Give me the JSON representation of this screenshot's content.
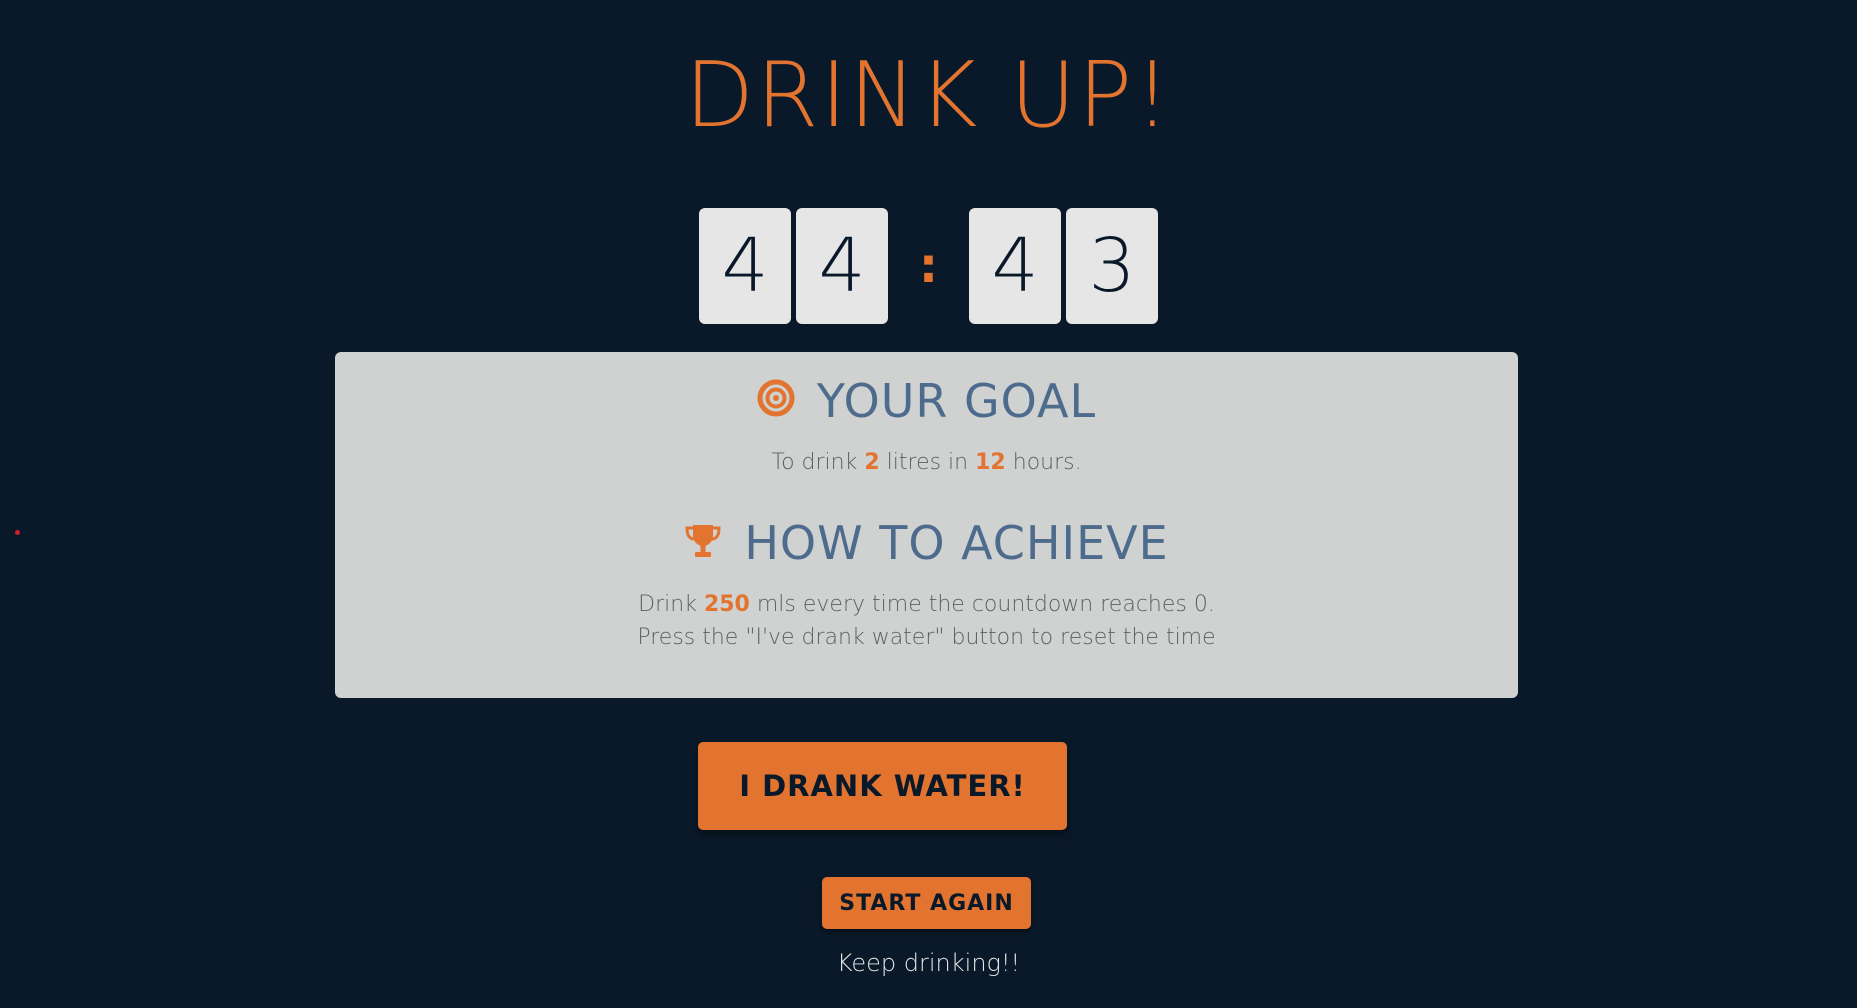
{
  "app": {
    "title": "DRINK UP!"
  },
  "countdown": {
    "minutes_tens": "4",
    "minutes_ones": "4",
    "separator": ":",
    "seconds_tens": "4",
    "seconds_ones": "3"
  },
  "goal": {
    "heading": "YOUR GOAL",
    "icon": "target-icon",
    "text_prefix": "To drink",
    "litres": "2",
    "text_mid": "litres in",
    "hours": "12",
    "text_suffix": "hours."
  },
  "achieve": {
    "heading": "HOW TO ACHIEVE",
    "icon": "trophy-icon",
    "line1_prefix": "Drink",
    "mls": "250",
    "line1_suffix": "mls every time the countdown reaches 0.",
    "line2": "Press the \"I've drank water\" button to reset the time"
  },
  "buttons": {
    "drank_label": "I DRANK WATER!",
    "start_again_label": "START AGAIN"
  },
  "status": {
    "message": "Keep drinking!!"
  },
  "colors": {
    "background": "#0a1929",
    "accent": "#e2742f",
    "card": "#d0d1d1",
    "heading": "#4d6b8c",
    "digit_bg": "#e6e6e6"
  }
}
